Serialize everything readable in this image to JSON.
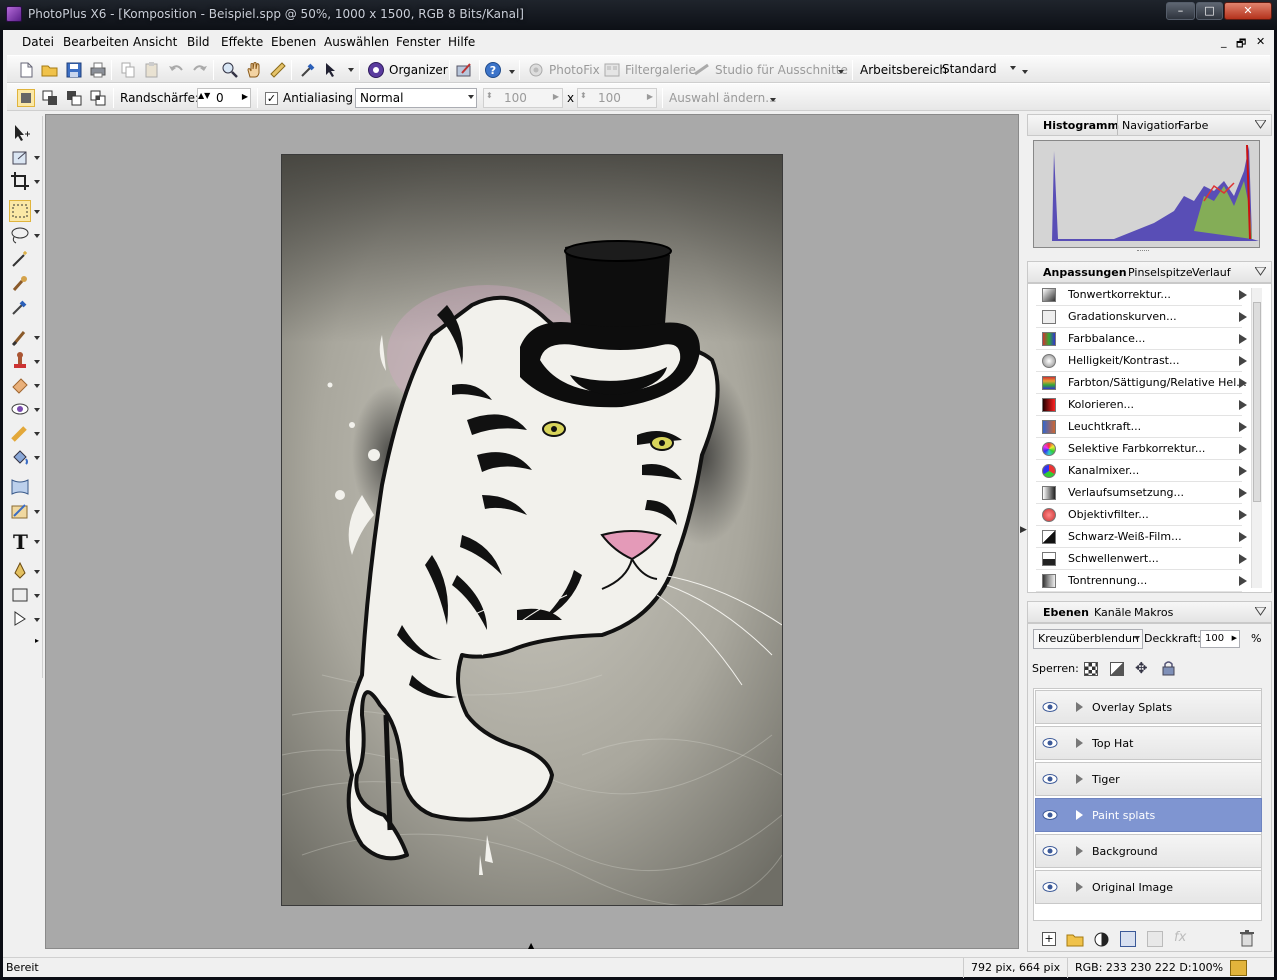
{
  "window": {
    "title": "PhotoPlus X6 - [Komposition - Beispiel.spp @ 50%, 1000 x 1500, RGB 8 Bits/Kanal]",
    "minimize": "–",
    "maximize": "□",
    "close": "✕"
  },
  "menu": {
    "items": [
      "Datei",
      "Bearbeiten",
      "Ansicht",
      "Bild",
      "Effekte",
      "Ebenen",
      "Auswählen",
      "Fenster",
      "Hilfe"
    ],
    "mdi": [
      "_",
      "🗗",
      "✕"
    ]
  },
  "toolbar": {
    "organizer_label": "Organizer",
    "photofix_label": "PhotoFix",
    "filtergalerie_label": "Filtergalerie",
    "studio_label": "Studio für Ausschnitte",
    "arbeitsbereich_label": "Arbeitsbereich",
    "arbeitsbereich_value": "Standard"
  },
  "context_toolbar": {
    "randschaerfe_label": "Randschärfe:",
    "randschaerfe_value": "0",
    "antialiasing_label": "Antialiasing",
    "antialiasing_checked": true,
    "mode_value": "Normal",
    "width_value": "100",
    "x_label": "x",
    "height_value": "100",
    "auswahl_label": "Auswahl ändern..."
  },
  "panels": {
    "histogram": {
      "tabs": [
        "Histogramm",
        "Navigation",
        "Farbe"
      ],
      "active": "Histogramm"
    },
    "adjustments": {
      "tabs": [
        "Anpassungen",
        "Pinselspitze",
        "Verlauf"
      ],
      "items": [
        "Tonwertkorrektur...",
        "Gradationskurven...",
        "Farbbalance...",
        "Helligkeit/Kontrast...",
        "Farbton/Sättigung/Relative Hel...",
        "Kolorieren...",
        "Leuchtkraft...",
        "Selektive Farbkorrektur...",
        "Kanalmixer...",
        "Verlaufsumsetzung...",
        "Objektivfilter...",
        "Schwarz-Weiß-Film...",
        "Schwellenwert...",
        "Tontrennung..."
      ]
    },
    "layers": {
      "tabs": [
        "Ebenen",
        "Kanäle",
        "Makros"
      ],
      "blend_mode": "Kreuzüberblendun",
      "opacity_label": "Deckkraft:",
      "opacity_value": "100",
      "opacity_unit": "%",
      "lock_label": "Sperren:",
      "items": [
        {
          "name": "Overlay Splats",
          "selected": false
        },
        {
          "name": "Top Hat",
          "selected": false
        },
        {
          "name": "Tiger",
          "selected": false
        },
        {
          "name": "Paint splats",
          "selected": true
        },
        {
          "name": "Background",
          "selected": false
        },
        {
          "name": "Original Image",
          "selected": false
        }
      ]
    }
  },
  "status": {
    "text": "Bereit",
    "position": "792 pix, 664 pix",
    "color": "RGB: 233 230 222 D:100%"
  },
  "colors": {
    "selection": "#7f95d1",
    "workspace": "#a9a9a9",
    "hat": "#0d0d0d",
    "tiger_fill": "#f2f1ec",
    "tiger_nose": "#e49ab8",
    "tiger_eye": "#d8d45a"
  }
}
